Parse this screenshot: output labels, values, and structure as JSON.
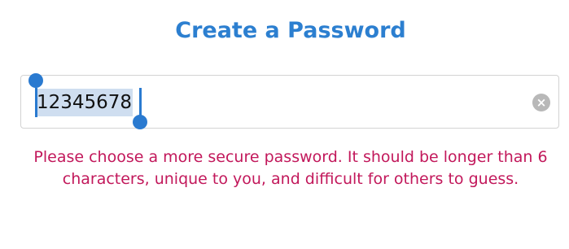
{
  "header": {
    "title": "Create a Password"
  },
  "password_field": {
    "value": "12345678",
    "selected": true,
    "clear_glyph": "×"
  },
  "validation": {
    "message": "Please choose a more secure password. It should be longer than 6 characters, unique to you, and difficult for others to guess."
  },
  "colors": {
    "title": "#2c7fd0",
    "selection": "#cfdef0",
    "caret": "#2a7ad0",
    "error": "#c2185b",
    "clear_button": "#b8b8b8"
  },
  "icons": {
    "clear": "clear-icon",
    "selection_handles": "selection-handle-icon"
  }
}
